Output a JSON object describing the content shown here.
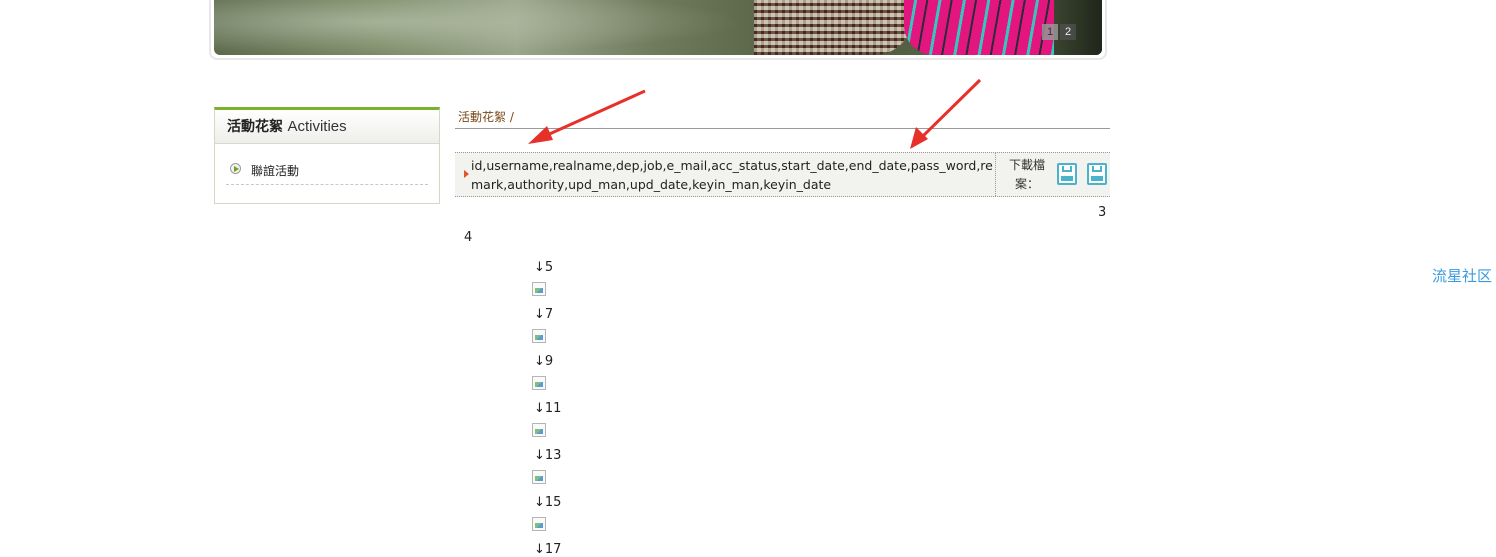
{
  "banner": {
    "pager": [
      "1",
      "2"
    ],
    "active_page": "1"
  },
  "sidebar": {
    "title_zh": "活動花絮",
    "title_en": "Activities",
    "items": [
      {
        "label": "聯誼活動",
        "icon": "play-bullet-icon"
      }
    ]
  },
  "content": {
    "breadcrumb": "活動花絮 /",
    "file": {
      "name": "id,username,realname,dep,job,e_mail,acc_status,start_date,end_date,pass_word,remark,authority,upd_man,upd_date,keyin_man,keyin_date",
      "download_label": "下載檔案：",
      "download_icons": [
        "floppy-disk-icon",
        "floppy-disk-icon"
      ]
    },
    "page_numbers": [
      "3",
      "4"
    ],
    "list_items": [
      "↓5",
      "↓7",
      "↓9",
      "↓11",
      "↓13",
      "↓15",
      "↓17"
    ]
  },
  "watermark": "流星社区",
  "annotation_color": "#e8302a",
  "accent_color": "#7ab22e",
  "icon_color": "#4ab3c9"
}
